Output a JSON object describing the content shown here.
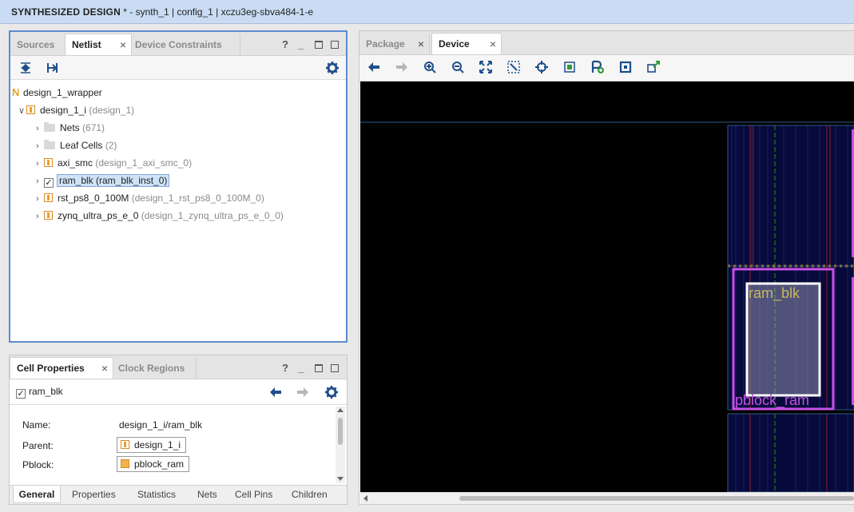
{
  "title": {
    "design": "SYNTHESIZED DESIGN",
    "rest": " * - synth_1 | config_1 | xczu3eg-sbva484-1-e"
  },
  "netlist_panel": {
    "tabs": [
      {
        "label": "Sources"
      },
      {
        "label": "Netlist"
      },
      {
        "label": "Device Constraints"
      }
    ],
    "close_glyph": "×",
    "help_glyph": "?",
    "tree": {
      "root": "design_1_wrapper",
      "root_icon": "N",
      "child": {
        "name": "design_1_i",
        "detail": "(design_1)"
      },
      "items": [
        {
          "name": "Nets",
          "detail": "(671)"
        },
        {
          "name": "Leaf Cells",
          "detail": "(2)"
        },
        {
          "name": "axi_smc",
          "detail": "(design_1_axi_smc_0)"
        },
        {
          "name": "ram_blk (ram_blk_inst_0)",
          "detail": ""
        },
        {
          "name": "rst_ps8_0_100M",
          "detail": "(design_1_rst_ps8_0_100M_0)"
        },
        {
          "name": "zynq_ultra_ps_e_0",
          "detail": "(design_1_zynq_ultra_ps_e_0_0)"
        }
      ]
    }
  },
  "properties_panel": {
    "tabs": [
      {
        "label": "Cell Properties"
      },
      {
        "label": "Clock Regions"
      }
    ],
    "selected": "ram_blk",
    "checkbox_mark": "✓",
    "rows": [
      {
        "label": "Name:",
        "value": "design_1_i/ram_blk"
      },
      {
        "label": "Parent:",
        "value": "design_1_i"
      },
      {
        "label": "Pblock:",
        "value": "pblock_ram"
      }
    ],
    "bottom_tabs": [
      "General",
      "Properties",
      "Statistics",
      "Nets",
      "Cell Pins",
      "Children"
    ]
  },
  "device_panel": {
    "tabs": [
      {
        "label": "Package"
      },
      {
        "label": "Device"
      }
    ],
    "canvas_labels": {
      "cell": "ram_blk",
      "pblock": "pblock_ram"
    }
  },
  "colors": {
    "accent_border": "#5b8ccf",
    "pblock": "#c651e6",
    "cell_label": "#c7b85f"
  }
}
